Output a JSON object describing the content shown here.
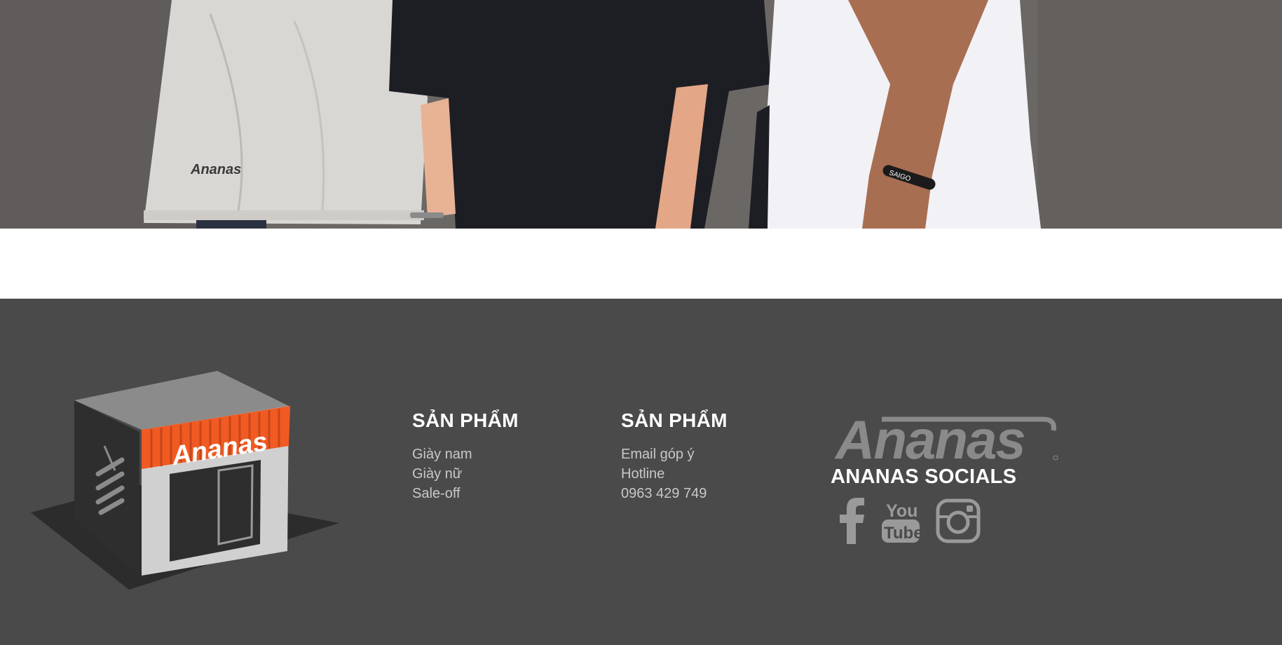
{
  "hero": {
    "image": "three-people-wearing-ananas-tshirts",
    "shirt_logo_text": "Ananas",
    "wristband_text": "SAIGO"
  },
  "footer": {
    "store_sign_text": "Ananas",
    "products_column": {
      "title": "SẢN PHẨM",
      "links": [
        "Giày nam",
        "Giày nữ",
        "Sale-off"
      ]
    },
    "support_column": {
      "title": "SẢN PHẨM",
      "links": [
        "Email góp ý",
        "Hotline",
        "0963 429 749"
      ]
    },
    "brand_logo_text": "Ananas",
    "socials_title": "ANANAS SOCIALS",
    "socials": [
      {
        "name": "Facebook",
        "icon": "facebook-icon"
      },
      {
        "name": "YouTube",
        "icon": "youtube-icon",
        "text_top": "You",
        "text_bottom": "Tube"
      },
      {
        "name": "Instagram",
        "icon": "instagram-icon"
      }
    ],
    "colors": {
      "footer_bg": "#4a4a4a",
      "store_orange": "#f15a22",
      "link_gray": "#c8c8c8",
      "logo_gray": "#8a8a8a"
    }
  }
}
